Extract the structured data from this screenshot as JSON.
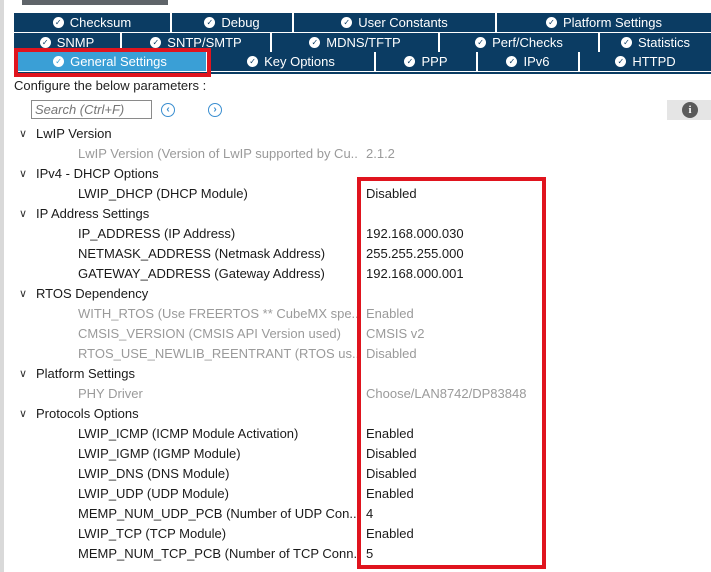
{
  "tabs_row1": [
    {
      "label": "Checksum"
    },
    {
      "label": "Debug"
    },
    {
      "label": "User Constants"
    },
    {
      "label": "Platform Settings"
    }
  ],
  "tabs_row2": [
    {
      "label": "SNMP"
    },
    {
      "label": "SNTP/SMTP"
    },
    {
      "label": "MDNS/TFTP"
    },
    {
      "label": "Perf/Checks"
    },
    {
      "label": "Statistics"
    }
  ],
  "tabs_row3": [
    {
      "label": "General Settings",
      "active": true
    },
    {
      "label": "Key Options"
    },
    {
      "label": "PPP"
    },
    {
      "label": "IPv6"
    },
    {
      "label": "HTTPD"
    }
  ],
  "configure_text": "Configure the below parameters :",
  "search": {
    "placeholder": "Search (Ctrl+F)"
  },
  "categories": [
    {
      "name": "LwIP Version",
      "params": [
        {
          "label": "LwIP Version (Version of LwIP supported by Cu...",
          "value": "2.1.2",
          "disabled": true
        }
      ]
    },
    {
      "name": "IPv4 - DHCP Options",
      "params": [
        {
          "label": "LWIP_DHCP (DHCP Module)",
          "value": "Disabled",
          "disabled": false
        }
      ]
    },
    {
      "name": "IP Address Settings",
      "params": [
        {
          "label": "IP_ADDRESS (IP Address)",
          "value": "192.168.000.030",
          "disabled": false
        },
        {
          "label": "NETMASK_ADDRESS (Netmask Address)",
          "value": "255.255.255.000",
          "disabled": false
        },
        {
          "label": "GATEWAY_ADDRESS (Gateway Address)",
          "value": "192.168.000.001",
          "disabled": false
        }
      ]
    },
    {
      "name": "RTOS Dependency",
      "params": [
        {
          "label": "WITH_RTOS (Use FREERTOS ** CubeMX spe...",
          "value": "Enabled",
          "disabled": true
        },
        {
          "label": "CMSIS_VERSION (CMSIS API Version used)",
          "value": "CMSIS v2",
          "disabled": true
        },
        {
          "label": "RTOS_USE_NEWLIB_REENTRANT (RTOS us...",
          "value": "Disabled",
          "disabled": true
        }
      ]
    },
    {
      "name": "Platform Settings",
      "params": [
        {
          "label": "PHY Driver",
          "value": "Choose/LAN8742/DP83848",
          "disabled": true
        }
      ]
    },
    {
      "name": "Protocols Options",
      "params": [
        {
          "label": "LWIP_ICMP (ICMP Module Activation)",
          "value": "Enabled",
          "disabled": false
        },
        {
          "label": "LWIP_IGMP (IGMP Module)",
          "value": "Disabled",
          "disabled": false
        },
        {
          "label": "LWIP_DNS (DNS Module)",
          "value": "Disabled",
          "disabled": false
        },
        {
          "label": "LWIP_UDP (UDP Module)",
          "value": "Enabled",
          "disabled": false
        },
        {
          "label": "MEMP_NUM_UDP_PCB (Number of UDP Con...",
          "value": "4",
          "disabled": false
        },
        {
          "label": "LWIP_TCP (TCP Module)",
          "value": "Enabled",
          "disabled": false
        },
        {
          "label": "MEMP_NUM_TCP_PCB (Number of TCP Conn...",
          "value": "5",
          "disabled": false
        }
      ]
    }
  ],
  "colors": {
    "tab_bg": "#0b3c63",
    "tab_active": "#3a9fd6",
    "highlight": "#e0141e"
  }
}
